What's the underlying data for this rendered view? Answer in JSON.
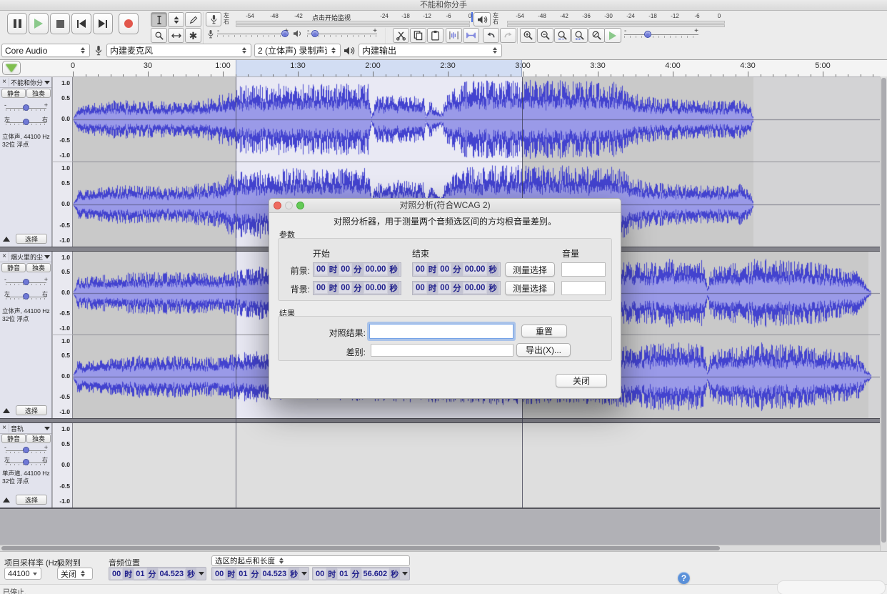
{
  "window": {
    "title": "不能和你分手"
  },
  "transport": {
    "pause": "pause-icon",
    "play": "play-icon",
    "stop": "stop-icon",
    "skip_start": "skip-to-start-icon",
    "skip_end": "skip-to-end-icon",
    "record": "record-icon"
  },
  "tools": {
    "selection": "selection-tool",
    "envelope": "envelope-tool",
    "draw": "draw-tool",
    "zoom": "zoom-tool",
    "timeshift": "time-shift-tool",
    "multi": "multi-tool",
    "multi_glyph": "✱"
  },
  "meters": {
    "channel_left": "左",
    "channel_right": "右",
    "monitor_hint": "点击开始监视",
    "record_scale_left": [
      "-54",
      "-48",
      "-42"
    ],
    "record_scale_right": [
      "-24",
      "-18",
      "-12",
      "-6",
      "0"
    ],
    "play_scale": [
      "-54",
      "-48",
      "-42",
      "-36",
      "-30",
      "-24",
      "-18",
      "-12",
      "-6",
      "0"
    ]
  },
  "mixer": {
    "minus": "-",
    "plus": "+"
  },
  "device": {
    "host": "Core Audio",
    "input": "内建麦克风",
    "channels": "2 (立体声) 录制声道",
    "output": "内建输出"
  },
  "ruler": {
    "labels": [
      "0",
      "30",
      "1:00",
      "1:30",
      "2:00",
      "2:30",
      "3:00",
      "3:30",
      "4:00",
      "4:30",
      "5:00"
    ]
  },
  "tracks": [
    {
      "title": "不能和你分手",
      "close": "×",
      "mute": "静音",
      "solo": "独奏",
      "gain_min": "-",
      "gain_max": "+",
      "pan_left": "左",
      "pan_right": "右",
      "info_line1": "立体声, 44100 Hz",
      "info_line2": "32位 浮点",
      "select": "选择",
      "scale": [
        "1.0",
        "0.5",
        "0.0",
        "-0.5",
        "-1.0"
      ]
    },
    {
      "title": "烟火里的尘埃",
      "close": "×",
      "mute": "静音",
      "solo": "独奏",
      "gain_min": "-",
      "gain_max": "+",
      "pan_left": "左",
      "pan_right": "右",
      "info_line1": "立体声, 44100 Hz",
      "info_line2": "32位 浮点",
      "select": "选择",
      "scale": [
        "1.0",
        "0.5",
        "0.0",
        "-0.5",
        "-1.0"
      ]
    },
    {
      "title": "音轨",
      "close": "×",
      "mute": "静音",
      "solo": "独奏",
      "gain_min": "-",
      "gain_max": "+",
      "pan_left": "左",
      "pan_right": "右",
      "info_line1": "单声道, 44100 Hz",
      "info_line2": "32位 浮点",
      "select": "选择",
      "scale": [
        "1.0",
        "0.5",
        "0.0",
        "-0.5",
        "-1.0"
      ]
    }
  ],
  "dialog": {
    "title": "对照分析(符合WCAG 2)",
    "description": "对照分析器，用于测量两个音频选区间的方均根音量差别。",
    "params_section": "参数",
    "col_start": "开始",
    "col_end": "结束",
    "col_volume": "音量",
    "row_foreground": "前景:",
    "row_background": "背景:",
    "measure_button": "测量选择",
    "fg_start": "00 时 00 分 00.00 秒",
    "fg_end": "00 时 00 分 00.00 秒",
    "bg_start": "00 时 00 分 00.00 秒",
    "bg_end": "00 时 00 分 00.00 秒",
    "fg_volume": "",
    "bg_volume": "",
    "results_section": "结果",
    "result_label": "对照结果:",
    "result_value": "",
    "reset_button": "重置",
    "diff_label": "差别:",
    "diff_value": "",
    "export_button": "导出(X)...",
    "close_button": "关闭",
    "help_icon": "?"
  },
  "statusbar": {
    "rate_label": "项目采样率 (Hz)",
    "rate_value": "44100",
    "snap_label": "吸附到",
    "snap_value": "关闭",
    "position_label": "音频位置",
    "position_value": "00 时 01 分 04.523 秒",
    "selection_label": "选区的起点和长度",
    "selection_start": "00 时 01 分 04.523 秒",
    "selection_length": "00 时 01 分 56.602 秒",
    "status_message": "已停止."
  }
}
